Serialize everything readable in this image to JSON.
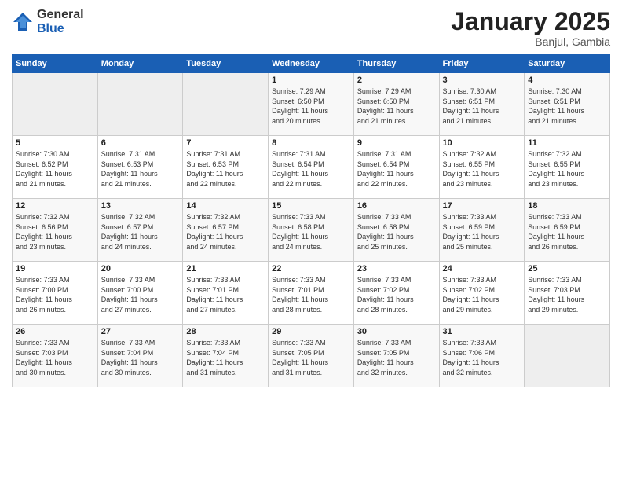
{
  "logo": {
    "general": "General",
    "blue": "Blue"
  },
  "header": {
    "month": "January 2025",
    "location": "Banjul, Gambia"
  },
  "days_of_week": [
    "Sunday",
    "Monday",
    "Tuesday",
    "Wednesday",
    "Thursday",
    "Friday",
    "Saturday"
  ],
  "weeks": [
    [
      {
        "day": "",
        "info": ""
      },
      {
        "day": "",
        "info": ""
      },
      {
        "day": "",
        "info": ""
      },
      {
        "day": "1",
        "info": "Sunrise: 7:29 AM\nSunset: 6:50 PM\nDaylight: 11 hours\nand 20 minutes."
      },
      {
        "day": "2",
        "info": "Sunrise: 7:29 AM\nSunset: 6:50 PM\nDaylight: 11 hours\nand 21 minutes."
      },
      {
        "day": "3",
        "info": "Sunrise: 7:30 AM\nSunset: 6:51 PM\nDaylight: 11 hours\nand 21 minutes."
      },
      {
        "day": "4",
        "info": "Sunrise: 7:30 AM\nSunset: 6:51 PM\nDaylight: 11 hours\nand 21 minutes."
      }
    ],
    [
      {
        "day": "5",
        "info": "Sunrise: 7:30 AM\nSunset: 6:52 PM\nDaylight: 11 hours\nand 21 minutes."
      },
      {
        "day": "6",
        "info": "Sunrise: 7:31 AM\nSunset: 6:53 PM\nDaylight: 11 hours\nand 21 minutes."
      },
      {
        "day": "7",
        "info": "Sunrise: 7:31 AM\nSunset: 6:53 PM\nDaylight: 11 hours\nand 22 minutes."
      },
      {
        "day": "8",
        "info": "Sunrise: 7:31 AM\nSunset: 6:54 PM\nDaylight: 11 hours\nand 22 minutes."
      },
      {
        "day": "9",
        "info": "Sunrise: 7:31 AM\nSunset: 6:54 PM\nDaylight: 11 hours\nand 22 minutes."
      },
      {
        "day": "10",
        "info": "Sunrise: 7:32 AM\nSunset: 6:55 PM\nDaylight: 11 hours\nand 23 minutes."
      },
      {
        "day": "11",
        "info": "Sunrise: 7:32 AM\nSunset: 6:55 PM\nDaylight: 11 hours\nand 23 minutes."
      }
    ],
    [
      {
        "day": "12",
        "info": "Sunrise: 7:32 AM\nSunset: 6:56 PM\nDaylight: 11 hours\nand 23 minutes."
      },
      {
        "day": "13",
        "info": "Sunrise: 7:32 AM\nSunset: 6:57 PM\nDaylight: 11 hours\nand 24 minutes."
      },
      {
        "day": "14",
        "info": "Sunrise: 7:32 AM\nSunset: 6:57 PM\nDaylight: 11 hours\nand 24 minutes."
      },
      {
        "day": "15",
        "info": "Sunrise: 7:33 AM\nSunset: 6:58 PM\nDaylight: 11 hours\nand 24 minutes."
      },
      {
        "day": "16",
        "info": "Sunrise: 7:33 AM\nSunset: 6:58 PM\nDaylight: 11 hours\nand 25 minutes."
      },
      {
        "day": "17",
        "info": "Sunrise: 7:33 AM\nSunset: 6:59 PM\nDaylight: 11 hours\nand 25 minutes."
      },
      {
        "day": "18",
        "info": "Sunrise: 7:33 AM\nSunset: 6:59 PM\nDaylight: 11 hours\nand 26 minutes."
      }
    ],
    [
      {
        "day": "19",
        "info": "Sunrise: 7:33 AM\nSunset: 7:00 PM\nDaylight: 11 hours\nand 26 minutes."
      },
      {
        "day": "20",
        "info": "Sunrise: 7:33 AM\nSunset: 7:00 PM\nDaylight: 11 hours\nand 27 minutes."
      },
      {
        "day": "21",
        "info": "Sunrise: 7:33 AM\nSunset: 7:01 PM\nDaylight: 11 hours\nand 27 minutes."
      },
      {
        "day": "22",
        "info": "Sunrise: 7:33 AM\nSunset: 7:01 PM\nDaylight: 11 hours\nand 28 minutes."
      },
      {
        "day": "23",
        "info": "Sunrise: 7:33 AM\nSunset: 7:02 PM\nDaylight: 11 hours\nand 28 minutes."
      },
      {
        "day": "24",
        "info": "Sunrise: 7:33 AM\nSunset: 7:02 PM\nDaylight: 11 hours\nand 29 minutes."
      },
      {
        "day": "25",
        "info": "Sunrise: 7:33 AM\nSunset: 7:03 PM\nDaylight: 11 hours\nand 29 minutes."
      }
    ],
    [
      {
        "day": "26",
        "info": "Sunrise: 7:33 AM\nSunset: 7:03 PM\nDaylight: 11 hours\nand 30 minutes."
      },
      {
        "day": "27",
        "info": "Sunrise: 7:33 AM\nSunset: 7:04 PM\nDaylight: 11 hours\nand 30 minutes."
      },
      {
        "day": "28",
        "info": "Sunrise: 7:33 AM\nSunset: 7:04 PM\nDaylight: 11 hours\nand 31 minutes."
      },
      {
        "day": "29",
        "info": "Sunrise: 7:33 AM\nSunset: 7:05 PM\nDaylight: 11 hours\nand 31 minutes."
      },
      {
        "day": "30",
        "info": "Sunrise: 7:33 AM\nSunset: 7:05 PM\nDaylight: 11 hours\nand 32 minutes."
      },
      {
        "day": "31",
        "info": "Sunrise: 7:33 AM\nSunset: 7:06 PM\nDaylight: 11 hours\nand 32 minutes."
      },
      {
        "day": "",
        "info": ""
      }
    ]
  ]
}
